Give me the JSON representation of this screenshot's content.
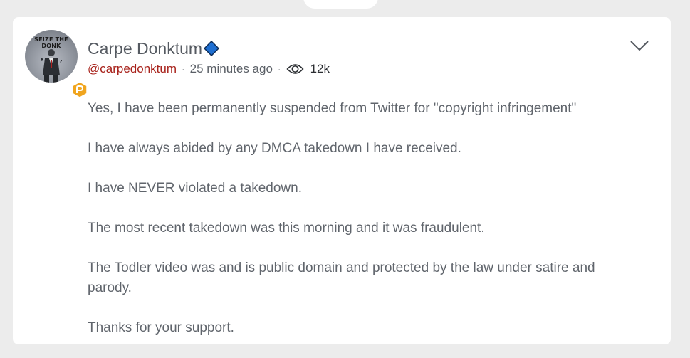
{
  "post": {
    "author_name": "Carpe Donktum",
    "handle": "@carpedonktum",
    "separator": "·",
    "timestamp": "25 minutes ago",
    "views": "12k",
    "avatar_text": "SEIZE THE DONK",
    "paragraphs": [
      "Yes, I have been permanently suspended from Twitter for \"copyright infringement\"",
      "I have always abided by any DMCA takedown I have received.",
      "I have NEVER violated a takedown.",
      "The most recent takedown was this morning and it was fraudulent.",
      "The Todler video was and is public domain and protected by the law under satire and parody.",
      "Thanks for your support."
    ]
  },
  "icons": {
    "verified": "verified-diamond-icon",
    "badge": "parler-badge-icon",
    "views": "eye-icon",
    "menu": "chevron-down-icon"
  },
  "colors": {
    "handle": "#a8221b",
    "verified": "#1f6fd1",
    "badge": "#f0a51e",
    "body_text": "#60656c",
    "background": "#ececec",
    "card": "#ffffff"
  }
}
